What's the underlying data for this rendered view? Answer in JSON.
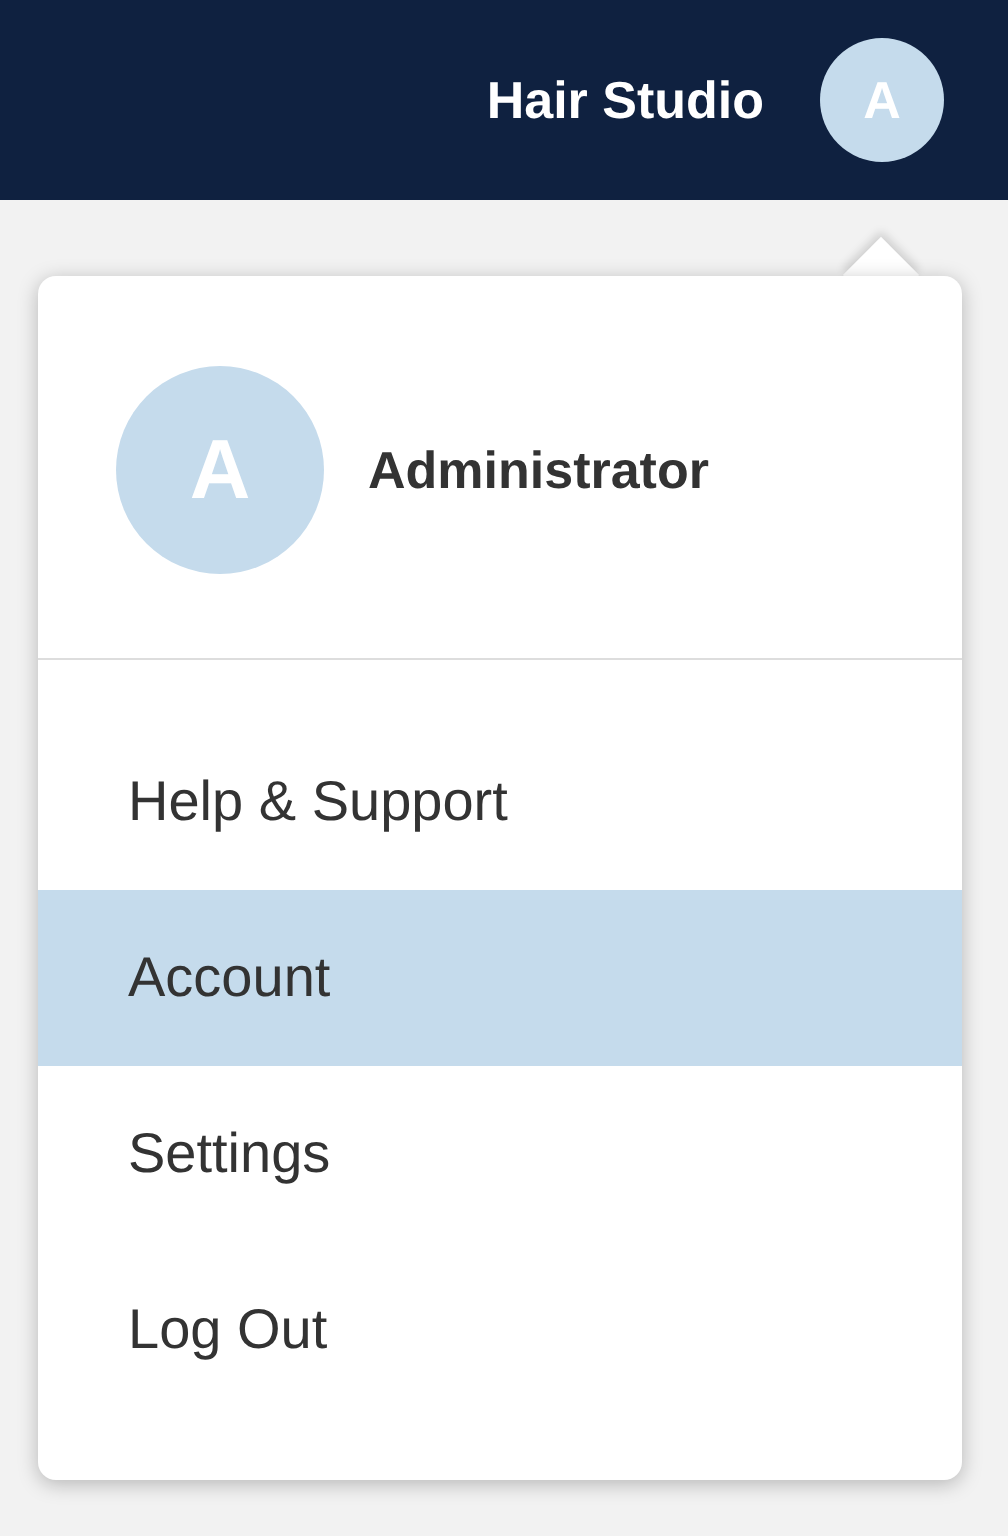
{
  "header": {
    "title": "Hair Studio",
    "avatar_initial": "A"
  },
  "menu": {
    "user": {
      "initial": "A",
      "name": "Administrator"
    },
    "items": [
      {
        "label": "Help & Support",
        "selected": false
      },
      {
        "label": "Account",
        "selected": true
      },
      {
        "label": "Settings",
        "selected": false
      },
      {
        "label": "Log Out",
        "selected": false
      }
    ]
  }
}
